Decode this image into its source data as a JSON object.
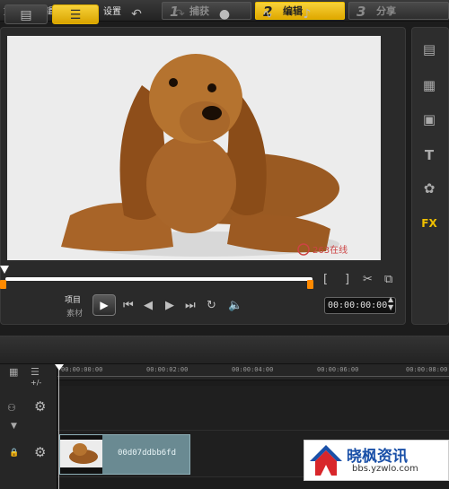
{
  "menu": {
    "file": "文件",
    "edit": "编辑",
    "tools": "工具",
    "settings": "设置"
  },
  "steps": [
    {
      "num": "1",
      "label": "捕获",
      "active": false
    },
    {
      "num": "2",
      "label": "编辑",
      "active": true
    },
    {
      "num": "3",
      "label": "分享",
      "active": false
    }
  ],
  "player": {
    "mode_project": "项目",
    "mode_clip": "素材",
    "timecode": "00:00:00:00",
    "watermark": "263在线"
  },
  "tools": {
    "fx": "FX"
  },
  "timeline": {
    "track_label": "+/-",
    "ticks": [
      "00:00:00:00",
      "00:00:02:00",
      "00:00:04:00",
      "00:00:06:00",
      "00:00:08:00"
    ],
    "clip_name": "00d07ddbb6fd"
  },
  "watermark": {
    "title": "晓枫资讯",
    "url": "bbs.yzwlo.com"
  },
  "colors": {
    "accent": "#f0c000",
    "marker": "#ff8a00",
    "clip": "#6a8a92"
  }
}
